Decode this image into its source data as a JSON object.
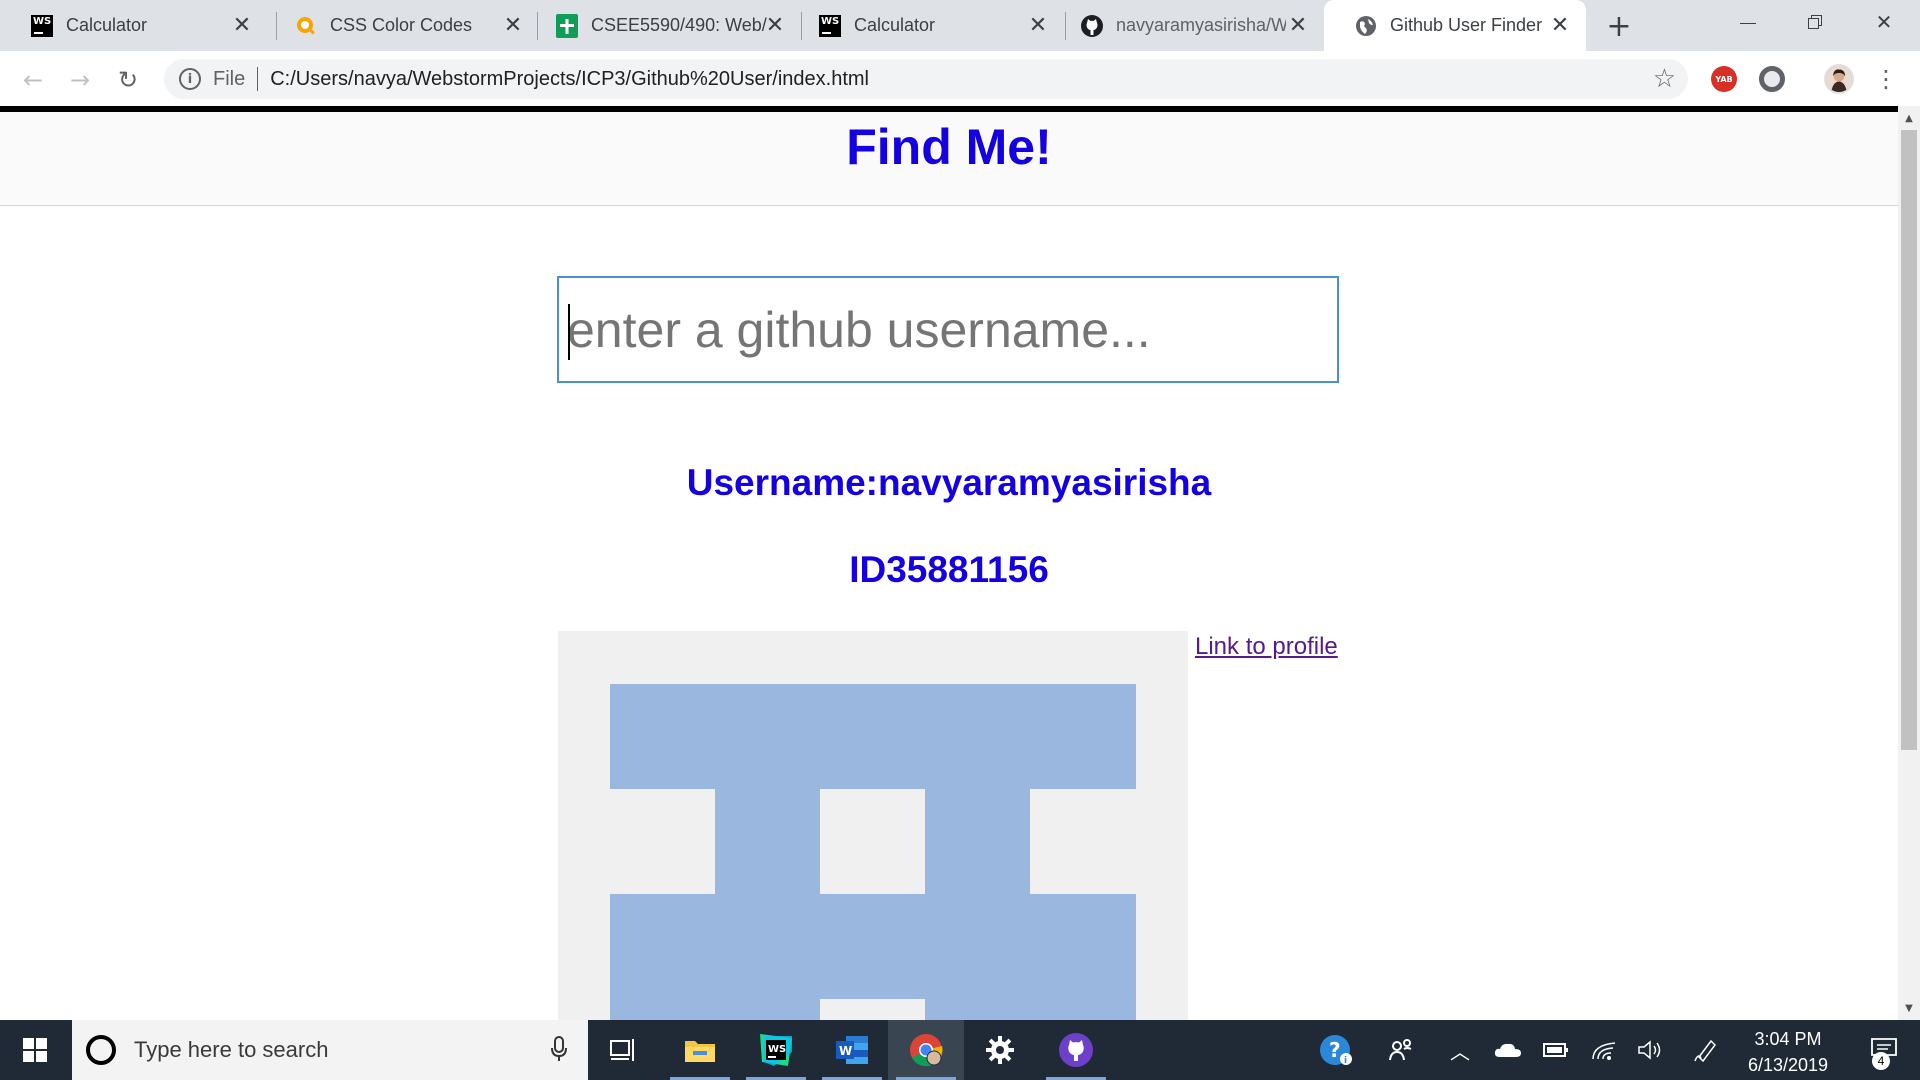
{
  "browser": {
    "tabs": [
      {
        "title": "Calculator",
        "icon": "webstorm-icon",
        "active": false
      },
      {
        "title": "CSS Color Codes",
        "icon": "magnifier-color-icon",
        "active": false
      },
      {
        "title": "CSEE5590/490: Web/",
        "icon": "google-sheets-icon",
        "active": false
      },
      {
        "title": "Calculator",
        "icon": "webstorm-icon",
        "active": false
      },
      {
        "title": "navyaramyasirisha/W",
        "icon": "github-icon",
        "active": false
      },
      {
        "title": "Github User Finder",
        "icon": "globe-icon",
        "active": true
      }
    ],
    "address": {
      "scheme": "File",
      "url": "C:/Users/navya/WebstormProjects/ICP3/Github%20User/index.html"
    },
    "extensions": [
      "YAB"
    ]
  },
  "page": {
    "heading": "Find Me!",
    "search": {
      "value": "",
      "placeholder": "enter a github username..."
    },
    "username_line": "Username:navyaramyasirisha",
    "id_line": "ID35881156",
    "profile_link": "Link to profile",
    "accent_color": "#1400e0",
    "avatar_color": "#9ab7e0"
  },
  "taskbar": {
    "search_placeholder": "Type here to search",
    "apps": [
      "task-view-icon",
      "file-explorer-icon",
      "webstorm-icon",
      "word-icon",
      "chrome-icon",
      "settings-icon",
      "github-desktop-icon"
    ],
    "time": "3:04 PM",
    "date": "6/13/2019",
    "notification_count": "4"
  }
}
